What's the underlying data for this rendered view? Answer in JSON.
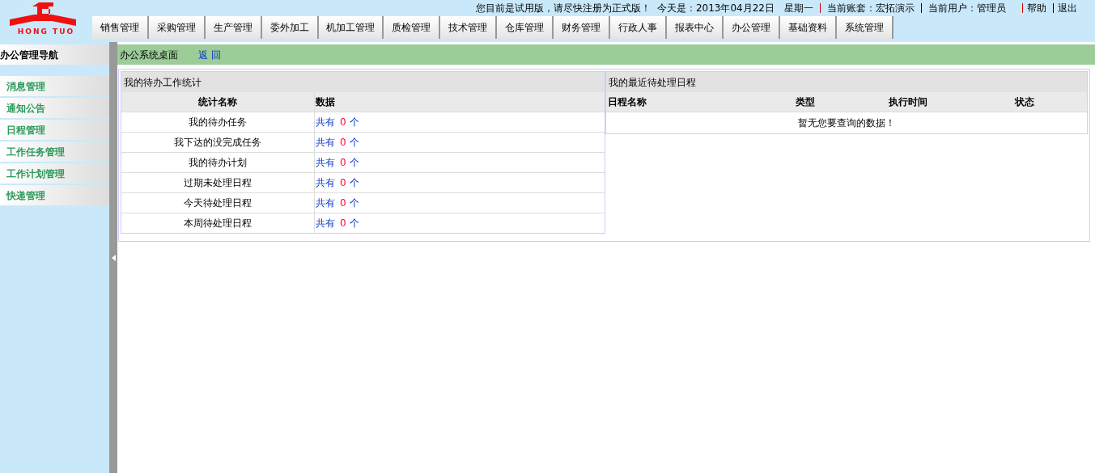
{
  "logo": {
    "text": "HONG TUO"
  },
  "top_bar": {
    "notice": "您目前是试用版，请尽快注册为正式版！",
    "today": "今天是：2013年04月22日　星期一",
    "account": "当前账套：宏拓演示",
    "user": "当前用户：管理员",
    "links": [
      "帮助",
      "退出"
    ]
  },
  "nav_tabs": [
    "销售管理",
    "采购管理",
    "生产管理",
    "委外加工",
    "机加工管理",
    "质检管理",
    "技术管理",
    "仓库管理",
    "财务管理",
    "行政人事",
    "报表中心",
    "办公管理",
    "基础资料",
    "系统管理"
  ],
  "sidebar": {
    "title": "办公管理导航",
    "items": [
      "消息管理",
      "通知公告",
      "日程管理",
      "工作任务管理",
      "工作计划管理",
      "快递管理"
    ]
  },
  "breadcrumb": {
    "title": "办公系统桌面",
    "back": "返 回"
  },
  "todo_panel": {
    "title": "我的待办工作统计",
    "columns": [
      "统计名称",
      "数据"
    ],
    "rows": [
      {
        "name": "我的待办任务",
        "prefix": "共有",
        "count": "0",
        "unit": "个"
      },
      {
        "name": "我下达的没完成任务",
        "prefix": "共有",
        "count": "0",
        "unit": "个"
      },
      {
        "name": "我的待办计划",
        "prefix": "共有",
        "count": "0",
        "unit": "个"
      },
      {
        "name": "过期未处理日程",
        "prefix": "共有",
        "count": "0",
        "unit": "个"
      },
      {
        "name": "今天待处理日程",
        "prefix": "共有",
        "count": "0",
        "unit": "个"
      },
      {
        "name": "本周待处理日程",
        "prefix": "共有",
        "count": "0",
        "unit": "个"
      }
    ]
  },
  "schedule_panel": {
    "title": "我的最近待处理日程",
    "columns": [
      "日程名称",
      "类型",
      "执行时间",
      "状态"
    ],
    "empty_message": "暂无您要查询的数据！"
  }
}
